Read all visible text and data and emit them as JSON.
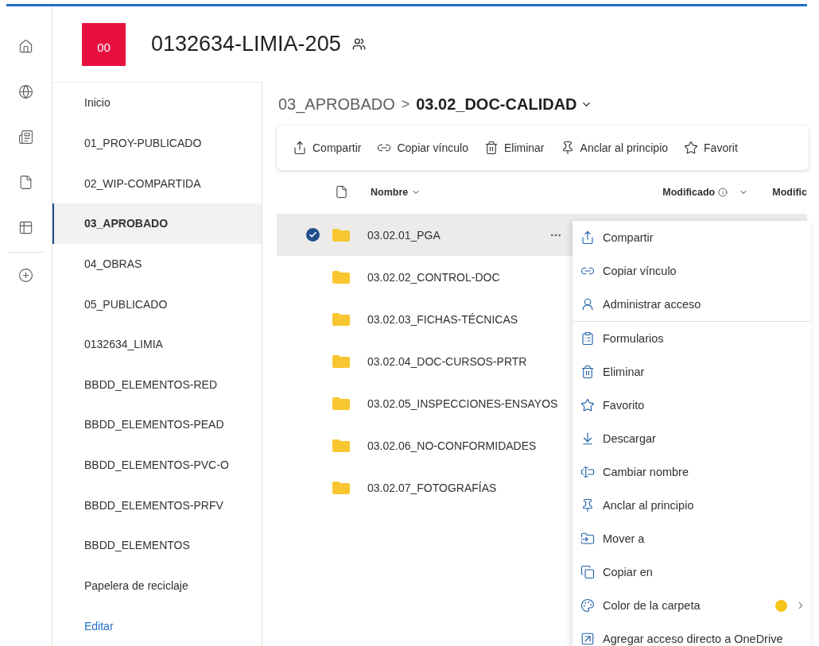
{
  "site": {
    "logo": "00",
    "title": "0132634-LIMIA-205"
  },
  "rail": [
    {
      "kind": "home",
      "selected": false
    },
    {
      "kind": "globe",
      "selected": false
    },
    {
      "kind": "news",
      "selected": false
    },
    {
      "kind": "file",
      "selected": false
    },
    {
      "kind": "list",
      "selected": false
    },
    {
      "kind": "add",
      "selected": false
    }
  ],
  "nav": {
    "items": [
      {
        "label": "Inicio",
        "selected": false
      },
      {
        "label": "01_PROY-PUBLICADO",
        "selected": false
      },
      {
        "label": "02_WIP-COMPARTIDA",
        "selected": false
      },
      {
        "label": "03_APROBADO",
        "selected": true
      },
      {
        "label": "04_OBRAS",
        "selected": false
      },
      {
        "label": "05_PUBLICADO",
        "selected": false
      },
      {
        "label": "0132634_LIMIA",
        "selected": false
      },
      {
        "label": "BBDD_ELEMENTOS-RED",
        "selected": false
      },
      {
        "label": "BBDD_ELEMENTOS-PEAD",
        "selected": false
      },
      {
        "label": "BBDD_ELEMENTOS-PVC-O",
        "selected": false
      },
      {
        "label": "BBDD_ELEMENTOS-PRFV",
        "selected": false
      },
      {
        "label": "BBDD_ELEMENTOS",
        "selected": false
      },
      {
        "label": "Papelera de reciclaje",
        "selected": false
      }
    ],
    "edit_link": "Editar"
  },
  "breadcrumb": {
    "parent": "03_APROBADO",
    "separator": ">",
    "current": "03.02_DOC-CALIDAD"
  },
  "toolbar": [
    {
      "kind": "share",
      "label": "Compartir"
    },
    {
      "kind": "link",
      "label": "Copiar vínculo"
    },
    {
      "kind": "delete",
      "label": "Eliminar"
    },
    {
      "kind": "pin",
      "label": "Anclar al principio"
    },
    {
      "kind": "star",
      "label": "Favorit"
    }
  ],
  "table": {
    "columns": [
      "Nombre",
      "Modificado",
      "Modific"
    ],
    "rows": [
      {
        "name": "03.02.01_PGA",
        "selected": true
      },
      {
        "name": "03.02.02_CONTROL-DOC",
        "selected": false
      },
      {
        "name": "03.02.03_FICHAS-TÉCNICAS",
        "selected": false
      },
      {
        "name": "03.02.04_DOC-CURSOS-PRTR",
        "selected": false
      },
      {
        "name": "03.02.05_INSPECCIONES-ENSAYOS",
        "selected": false
      },
      {
        "name": "03.02.06_NO-CONFORMIDADES",
        "selected": false
      },
      {
        "name": "03.02.07_FOTOGRAFÍAS",
        "selected": false
      }
    ]
  },
  "context_menu": [
    {
      "kind": "share",
      "label": "Compartir",
      "divider_after": false
    },
    {
      "kind": "link",
      "label": "Copiar vínculo",
      "divider_after": false
    },
    {
      "kind": "access",
      "label": "Administrar acceso",
      "divider_after": true
    },
    {
      "kind": "forms",
      "label": "Formularios",
      "divider_after": false
    },
    {
      "kind": "delete",
      "label": "Eliminar",
      "divider_after": false
    },
    {
      "kind": "star",
      "label": "Favorito",
      "divider_after": false
    },
    {
      "kind": "download",
      "label": "Descargar",
      "divider_after": false
    },
    {
      "kind": "rename",
      "label": "Cambiar nombre",
      "divider_after": false
    },
    {
      "kind": "pin",
      "label": "Anclar al principio",
      "divider_after": false
    },
    {
      "kind": "move",
      "label": "Mover a",
      "divider_after": false
    },
    {
      "kind": "copy",
      "label": "Copiar en",
      "divider_after": false
    },
    {
      "kind": "color",
      "label": "Color de la carpeta",
      "color": "#f5c518",
      "divider_after": false
    },
    {
      "kind": "shortcut",
      "label": "Agregar acceso directo a OneDrive",
      "divider_after": false
    }
  ]
}
